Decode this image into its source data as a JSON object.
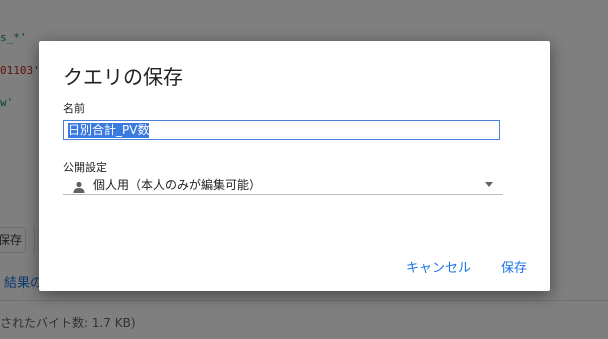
{
  "background": {
    "code_line1": "s_*'",
    "code_line2": "01103'",
    "code_line3": "w'",
    "toolbar_save_label": "保存",
    "results_link": "結果の",
    "bytes_text": "されたバイト数: 1.7 KB)"
  },
  "dialog": {
    "title": "クエリの保存",
    "name_label": "名前",
    "name_value": "日別合計_PV数",
    "visibility_label": "公開設定",
    "visibility_value": "個人用（本人のみが編集可能）",
    "visibility_icon": "person-icon",
    "cancel_label": "キャンセル",
    "save_label": "保存"
  },
  "colors": {
    "accent": "#1a73e8",
    "selection": "#3b7ae0"
  }
}
